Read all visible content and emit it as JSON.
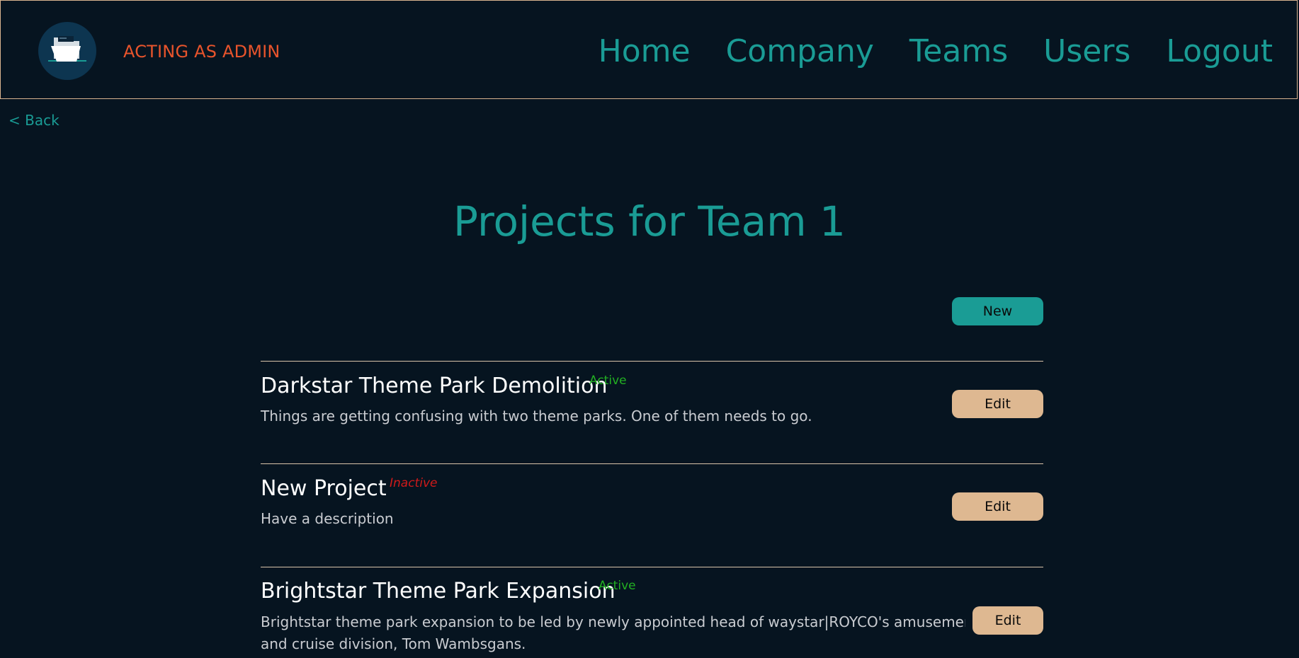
{
  "header": {
    "acting_label": "ACTING AS ADMIN",
    "nav": [
      "Home",
      "Company",
      "Teams",
      "Users",
      "Logout"
    ]
  },
  "back_label": "< Back",
  "page_title": "Projects for Team 1",
  "new_button_label": "New",
  "edit_label": "Edit",
  "projects": [
    {
      "title": "Darkstar Theme Park Demolition",
      "status": "Active",
      "description": "Things are getting confusing with two theme parks. One of them needs to go."
    },
    {
      "title": "New Project",
      "status": "Inactive",
      "description": "Have a description"
    },
    {
      "title": "Brightstar Theme Park Expansion",
      "status": "Active",
      "description_lines": [
        "Brightstar theme park expansion to be led by newly appointed head of waystar|ROYCO's amusement park",
        "and cruise division, Tom Wambsgans."
      ]
    }
  ],
  "colors": {
    "background": "#061420",
    "accent_teal": "#1a9c95",
    "acting_orange": "#e8542c",
    "edit_button": "#deb891",
    "status_active": "#22b022",
    "status_inactive": "#d01a1a"
  }
}
